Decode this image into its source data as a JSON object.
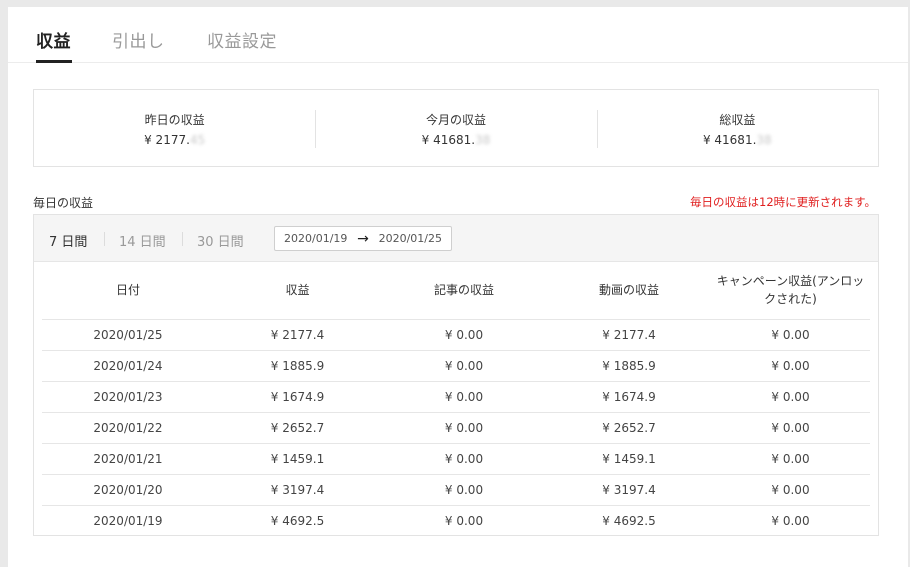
{
  "tabs": [
    {
      "label": "収益",
      "active": true
    },
    {
      "label": "引出し",
      "active": false
    },
    {
      "label": "収益設定",
      "active": false
    }
  ],
  "summary": [
    {
      "label": "昨日の収益",
      "value": "¥ 2177.",
      "hidden": "45"
    },
    {
      "label": "今月の収益",
      "value": "¥ 41681.",
      "hidden": "38"
    },
    {
      "label": "総収益",
      "value": "¥ 41681.",
      "hidden": "38"
    }
  ],
  "daily": {
    "title": "毎日の収益",
    "notice": "毎日の収益は12時に更新されます。",
    "ranges": [
      "7 日間",
      "14 日間",
      "30 日間"
    ],
    "active_range": "7 日間",
    "date_from": "2020/01/19",
    "date_to": "2020/01/25",
    "arrow": "→"
  },
  "table": {
    "headers": [
      "日付",
      "収益",
      "記事の収益",
      "動画の収益",
      "キャンペーン収益(アンロックされた)"
    ],
    "rows": [
      {
        "date": "2020/01/25",
        "revenue": "¥ 2177.4",
        "article": "¥ 0.00",
        "video": "¥ 2177.4",
        "campaign": "¥ 0.00"
      },
      {
        "date": "2020/01/24",
        "revenue": "¥ 1885.9",
        "article": "¥ 0.00",
        "video": "¥ 1885.9",
        "campaign": "¥ 0.00"
      },
      {
        "date": "2020/01/23",
        "revenue": "¥ 1674.9",
        "article": "¥ 0.00",
        "video": "¥ 1674.9",
        "campaign": "¥ 0.00"
      },
      {
        "date": "2020/01/22",
        "revenue": "¥ 2652.7",
        "article": "¥ 0.00",
        "video": "¥ 2652.7",
        "campaign": "¥ 0.00"
      },
      {
        "date": "2020/01/21",
        "revenue": "¥ 1459.1",
        "article": "¥ 0.00",
        "video": "¥ 1459.1",
        "campaign": "¥ 0.00"
      },
      {
        "date": "2020/01/20",
        "revenue": "¥ 3197.4",
        "article": "¥ 0.00",
        "video": "¥ 3197.4",
        "campaign": "¥ 0.00"
      },
      {
        "date": "2020/01/19",
        "revenue": "¥ 4692.5",
        "article": "¥ 0.00",
        "video": "¥ 4692.5",
        "campaign": "¥ 0.00"
      }
    ]
  },
  "colors": {
    "accent": "#222222",
    "notice": "#e01e1e",
    "muted": "#999999"
  }
}
